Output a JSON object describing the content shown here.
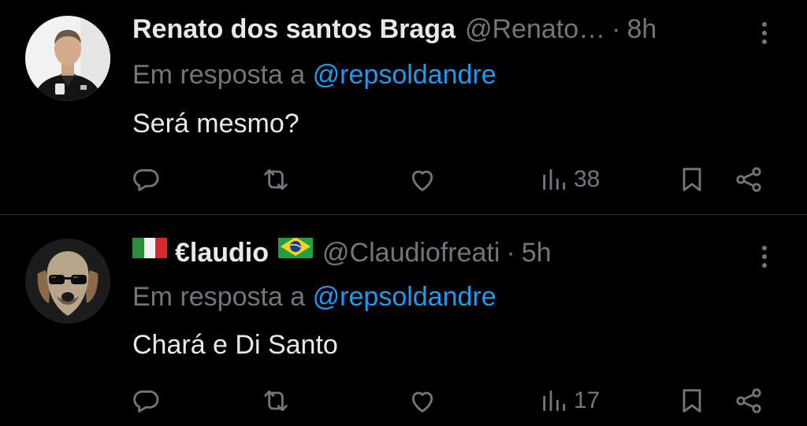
{
  "tweets": [
    {
      "name": "Renato dos santos Braga",
      "handle": "@Renato…",
      "separator": "·",
      "time": "8h",
      "reply_prefix": "Em resposta a",
      "reply_to": "@repsoldandre",
      "text": "Será mesmo?",
      "views": "38",
      "avatar": "avatar-man-photo"
    },
    {
      "name": "€laudio",
      "flag_before": "italy-flag",
      "flag_after": "brazil-flag",
      "handle": "@Claudiofreati",
      "separator": "·",
      "time": "5h",
      "reply_prefix": "Em resposta a",
      "reply_to": "@repsoldandre",
      "text": "Chará e Di Santo",
      "views": "17",
      "avatar": "avatar-dog-sunglasses"
    }
  ],
  "colors": {
    "background": "#000000",
    "text": "#e7e9ea",
    "muted": "#71767b",
    "link": "#1d9bf0",
    "divider": "#2f3336"
  },
  "icons": [
    "reply-icon",
    "retweet-icon",
    "like-icon",
    "views-icon",
    "bookmark-icon",
    "share-icon",
    "more-icon"
  ]
}
